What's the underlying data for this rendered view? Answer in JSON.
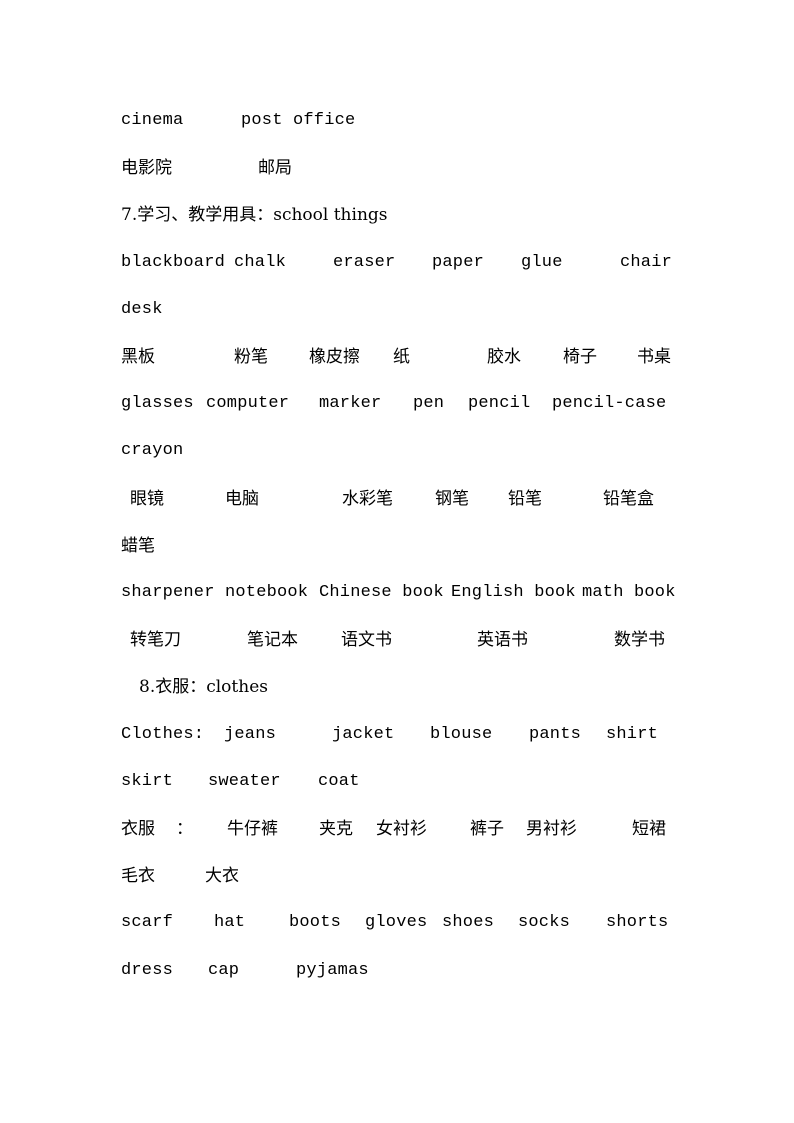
{
  "document": {
    "lines": [
      {
        "kind": "en",
        "words": [
          "cinema",
          "post office"
        ]
      },
      {
        "kind": "zh",
        "words": [
          "电影院",
          "邮局"
        ]
      },
      {
        "kind": "heading",
        "words": [
          "7.学习、教学用具：school things"
        ]
      },
      {
        "kind": "en",
        "words": [
          "blackboard",
          "chalk",
          "eraser",
          "paper",
          "glue",
          "chair"
        ]
      },
      {
        "kind": "en",
        "words": [
          "desk"
        ]
      },
      {
        "kind": "zh",
        "words": [
          "黑板",
          "粉笔",
          "橡皮擦",
          "纸",
          "胶水",
          "椅子",
          "书桌"
        ]
      },
      {
        "kind": "en",
        "words": [
          "glasses",
          "computer",
          "marker",
          "pen",
          "pencil",
          "pencil-case"
        ]
      },
      {
        "kind": "en",
        "words": [
          "crayon"
        ]
      },
      {
        "kind": "zh",
        "words": [
          "眼镜",
          "电脑",
          "水彩笔",
          "钢笔",
          "铅笔",
          "铅笔盒"
        ]
      },
      {
        "kind": "zh",
        "words": [
          "蜡笔"
        ]
      },
      {
        "kind": "en",
        "words": [
          "sharpener",
          "notebook",
          "Chinese book",
          "English book",
          "math book"
        ]
      },
      {
        "kind": "zh",
        "words": [
          "转笔刀",
          "笔记本",
          "语文书",
          "英语书",
          "数学书"
        ]
      },
      {
        "kind": "heading",
        "words": [
          "8.衣服：clothes"
        ]
      },
      {
        "kind": "en",
        "words": [
          "Clothes:",
          "jeans",
          "jacket",
          "blouse",
          "pants",
          "shirt"
        ]
      },
      {
        "kind": "en",
        "words": [
          "skirt",
          "sweater",
          "coat"
        ]
      },
      {
        "kind": "zh",
        "words": [
          "衣服",
          "：",
          "牛仔裤",
          "夹克",
          "女衬衫",
          "裤子",
          "男衬衫",
          "短裙"
        ]
      },
      {
        "kind": "zh",
        "words": [
          "毛衣",
          "大衣"
        ]
      },
      {
        "kind": "en",
        "words": [
          "scarf",
          "hat",
          "boots",
          "gloves",
          "shoes",
          "socks",
          "shorts"
        ]
      },
      {
        "kind": "en",
        "words": [
          "dress",
          "cap",
          "pyjamas"
        ]
      }
    ]
  }
}
